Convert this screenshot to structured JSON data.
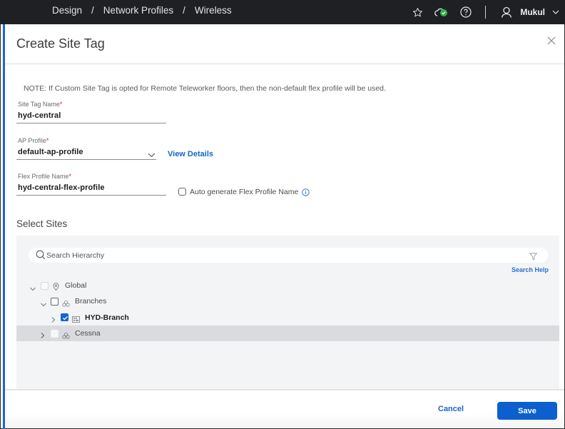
{
  "topbar": {
    "breadcrumb": [
      "Design",
      "Network Profiles",
      "Wireless"
    ],
    "separator": "/",
    "icons": [
      "star-icon",
      "cloud-status-icon",
      "help-icon",
      "user-icon",
      "chevron-down-icon"
    ],
    "user_name": "Mukul",
    "status_color": "#2bb44a"
  },
  "modal": {
    "title": "Create Site Tag",
    "note": "NOTE: If Custom Site Tag is opted for Remote Teleworker floors, then the non-default flex profile will be used.",
    "site_tag_name": {
      "label": "Site Tag Name",
      "required_mark": "*",
      "value": "hyd-central"
    },
    "ap_profile": {
      "label": "AP Profile",
      "required_mark": "*",
      "value": "default-ap-profile",
      "view_details": "View Details"
    },
    "flex_profile_name": {
      "label": "Flex Profile Name",
      "required_mark": "*",
      "value": "hyd-central-flex-profile"
    },
    "auto_generate": {
      "label": "Auto generate Flex Profile Name",
      "checked": false
    },
    "select_sites": {
      "title": "Select Sites",
      "search_placeholder": "Search Hierarchy",
      "search_help": "Search Help",
      "tree": [
        {
          "label": "Global",
          "expanded": true,
          "checked": false,
          "icon": "location-pin-icon"
        },
        {
          "label": "Branches",
          "expanded": true,
          "checked": false,
          "icon": "area-icon"
        },
        {
          "label": "HYD-Branch",
          "expanded": false,
          "checked": true,
          "icon": "building-icon"
        },
        {
          "label": "Cessna",
          "expanded": false,
          "checked": false,
          "icon": "area-icon"
        }
      ]
    },
    "footer": {
      "cancel": "Cancel",
      "save": "Save"
    }
  },
  "colors": {
    "accent": "#0b5fce",
    "link": "#1565c8",
    "required": "#d0271d"
  }
}
